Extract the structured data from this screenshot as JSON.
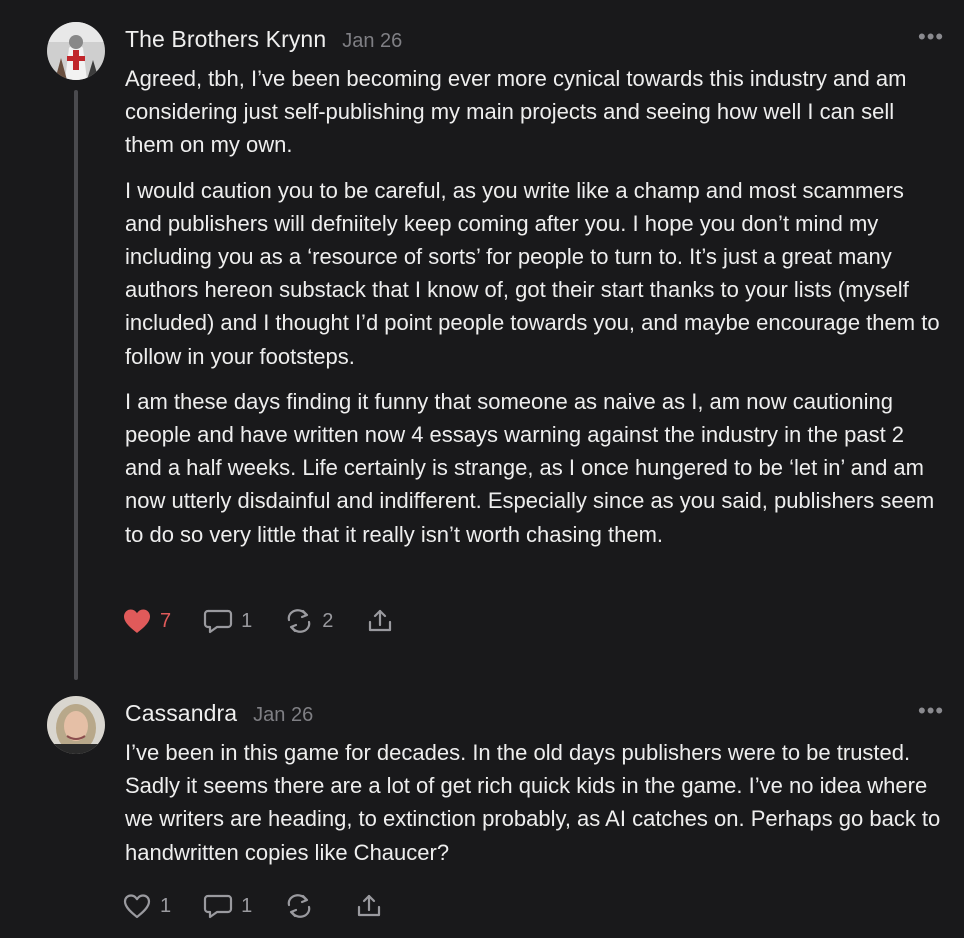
{
  "comments": [
    {
      "author": "The Brothers Krynn",
      "date": "Jan 26",
      "paragraphs": [
        "Agreed, tbh, I’ve been becoming ever more cynical towards this industry and am considering just self-publishing my main projects and seeing how well I can sell them on my own.",
        "I would caution you to be careful, as you write like a champ and most scammers and publishers will defniitely keep coming after you. I hope you don’t mind my including you as a ‘resource of sorts’ for people to turn to. It’s just a great many authors hereon substack that I know of, got their start thanks to your lists (myself included) and I thought I’d point people towards you, and maybe encourage them to follow in your footsteps.",
        "I am these days finding it funny that someone as naive as I, am now cautioning people and have written now 4 essays warning against the industry in the past 2 and a half weeks. Life certainly is strange, as I once hungered to be ‘let in’ and am now utterly disdainful and indifferent. Especially since as you said, publishers seem to do so very little that it really isn’t worth chasing them."
      ],
      "likes": "7",
      "liked": true,
      "replies": "1",
      "restacks": "2",
      "more_label": "•••"
    },
    {
      "author": "Cassandra",
      "date": "Jan 26",
      "paragraphs": [
        "I’ve been in this game for decades. In the old days publishers were to be trusted. Sadly it seems there are a lot of get rich quick kids in the game. I’ve no idea where we writers are heading, to extinction probably, as AI catches on. Perhaps go back to handwritten copies like Chaucer?"
      ],
      "likes": "1",
      "liked": false,
      "replies": "1",
      "restacks": "",
      "more_label": "•••"
    }
  ],
  "colors": {
    "background": "#19191b",
    "like_active": "#e05a5a",
    "muted": "#7f7f84"
  }
}
